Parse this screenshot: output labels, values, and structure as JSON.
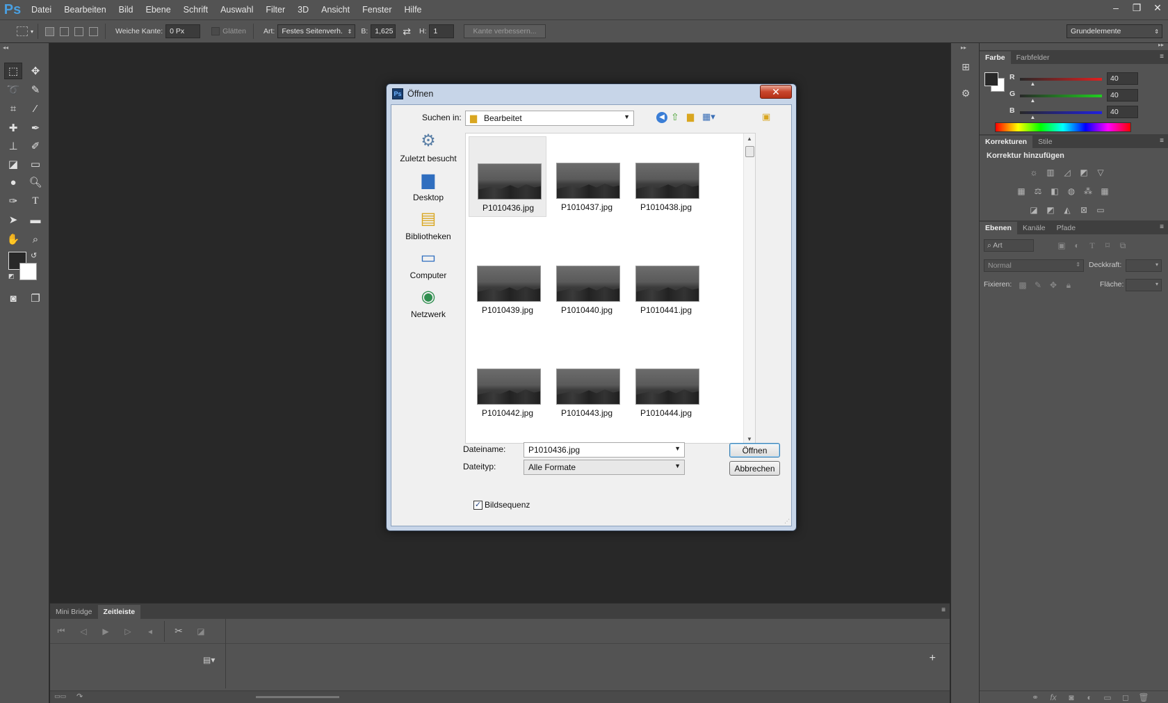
{
  "app": {
    "logo": "Ps",
    "menu": [
      "Datei",
      "Bearbeiten",
      "Bild",
      "Ebene",
      "Schrift",
      "Auswahl",
      "Filter",
      "3D",
      "Ansicht",
      "Fenster",
      "Hilfe"
    ],
    "window_controls": [
      "–",
      "❐",
      "✕"
    ]
  },
  "options": {
    "feather_label": "Weiche Kante:",
    "feather_value": "0 Px",
    "antialias_label": "Glätten",
    "style_label": "Art:",
    "style_value": "Festes Seitenverh.",
    "width_label": "B:",
    "width_value": "1,625",
    "height_label": "H:",
    "height_value": "1",
    "refine_button": "Kante verbessern...",
    "workspace": "Grundelemente"
  },
  "color_panel": {
    "tabs": [
      "Farbe",
      "Farbfelder"
    ],
    "r_label": "R",
    "r_value": "40",
    "g_label": "G",
    "g_value": "40",
    "b_label": "B",
    "b_value": "40",
    "r_level": 0.157,
    "g_level": 0.157,
    "b_level": 0.157,
    "fg_color": "#282828",
    "bg_color": "#ffffff"
  },
  "adjust_panel": {
    "tabs": [
      "Korrekturen",
      "Stile"
    ],
    "heading": "Korrektur hinzufügen"
  },
  "layers_panel": {
    "tabs": [
      "Ebenen",
      "Kanäle",
      "Pfade"
    ],
    "filter_value": "Art",
    "blend_mode": "Normal",
    "opacity_label": "Deckkraft:",
    "lock_label": "Fixieren:",
    "fill_label": "Fläche:"
  },
  "timeline": {
    "tabs": [
      "Mini Bridge",
      "Zeitleiste"
    ]
  },
  "dialog": {
    "title": "Öffnen",
    "close_label": "✕",
    "look_in_label": "Suchen in:",
    "look_in_value": "Bearbeitet",
    "places": [
      "Zuletzt besucht",
      "Desktop",
      "Bibliotheken",
      "Computer",
      "Netzwerk"
    ],
    "files": [
      "P1010436.jpg",
      "P1010437.jpg",
      "P1010438.jpg",
      "P1010439.jpg",
      "P1010440.jpg",
      "P1010441.jpg",
      "P1010442.jpg",
      "P1010443.jpg",
      "P1010444.jpg"
    ],
    "filename_label": "Dateiname:",
    "filename_value": "P1010436.jpg",
    "filetype_label": "Dateityp:",
    "filetype_value": "Alle Formate",
    "open_button": "Öffnen",
    "cancel_button": "Abbrechen",
    "sequence_label": "Bildsequenz",
    "sequence_checked": true
  }
}
